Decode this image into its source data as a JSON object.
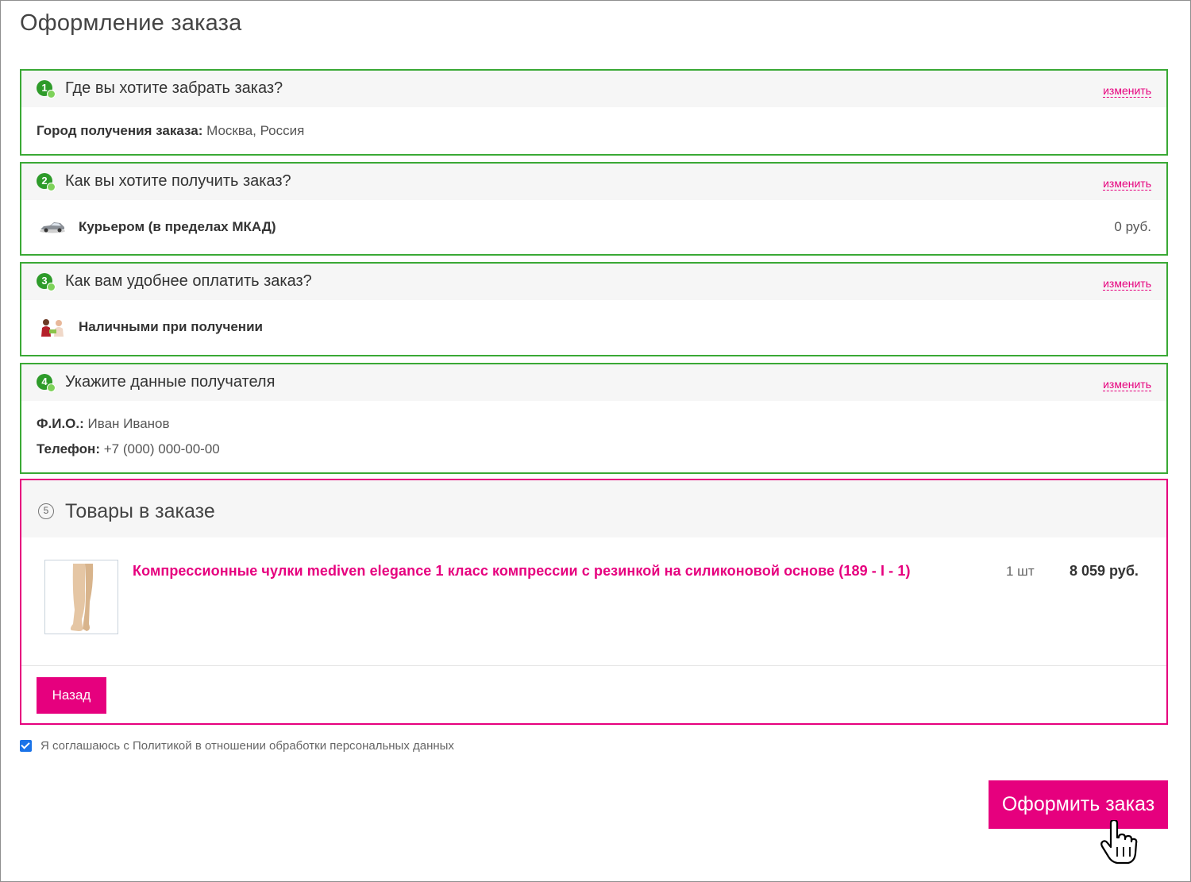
{
  "page": {
    "title": "Оформление заказа"
  },
  "steps": [
    {
      "num": "1",
      "title": "Где вы хотите забрать заказ?",
      "change_label": "изменить",
      "city_label": "Город получения заказа:",
      "city_value": "Москва, Россия"
    },
    {
      "num": "2",
      "title": "Как вы хотите получить заказ?",
      "change_label": "изменить",
      "delivery_label": "Курьером (в пределах МКАД)",
      "delivery_price": "0 руб.",
      "icon": "car-icon"
    },
    {
      "num": "3",
      "title": "Как вам удобнее оплатить заказ?",
      "change_label": "изменить",
      "payment_label": "Наличными при получении",
      "icon": "cash-payment-icon"
    },
    {
      "num": "4",
      "title": "Укажите данные получателя",
      "change_label": "изменить",
      "name_label": "Ф.И.О.:",
      "name_value": "Иван Иванов",
      "phone_label": "Телефон:",
      "phone_value": "+7 (000) 000-00-00"
    }
  ],
  "cart": {
    "num": "5",
    "title": "Товары в заказе",
    "items": [
      {
        "name": "Компрессионные чулки mediven elegance 1 класс компрессии с резинкой на силиконовой основе (189 - I - 1)",
        "qty": "1 шт",
        "price": "8 059 руб."
      }
    ],
    "back_label": "Назад"
  },
  "agreement": {
    "checked": true,
    "text": "Я соглашаюсь с Политикой в отношении обработки персональных данных"
  },
  "submit": {
    "label": "Оформить заказ"
  },
  "colors": {
    "accent": "#e6007e",
    "success": "#3aa935",
    "checkbox": "#1a73e8"
  }
}
